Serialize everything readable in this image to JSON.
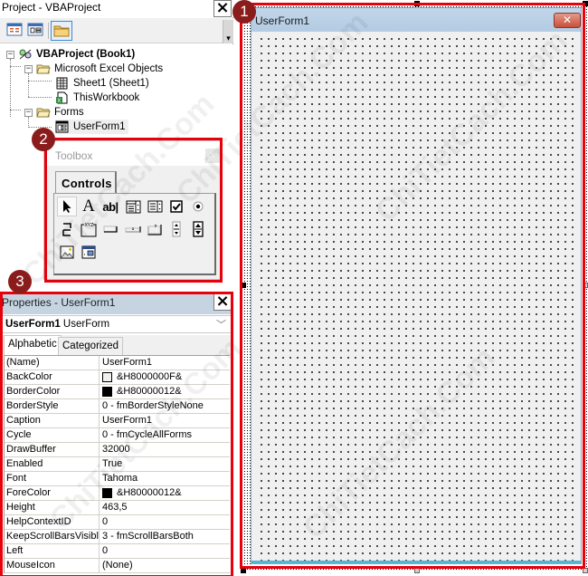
{
  "project_explorer": {
    "title": "Project - VBAProject",
    "toolbar": [
      {
        "name": "view-code-icon",
        "label": "View Code"
      },
      {
        "name": "view-object-icon",
        "label": "View Object"
      },
      {
        "name": "toggle-folders-icon",
        "label": "Toggle Folders"
      }
    ],
    "tree": {
      "root": "VBAProject (Book1)",
      "excel_objects_folder": "Microsoft Excel Objects",
      "sheet1": "Sheet1 (Sheet1)",
      "this_workbook": "ThisWorkbook",
      "forms_folder": "Forms",
      "userform1": "UserForm1"
    }
  },
  "toolbox": {
    "title": "Toolbox",
    "close_label": "x",
    "tab": "Controls",
    "tools": [
      {
        "name": "select-objects-tool",
        "glyph": "arrow"
      },
      {
        "name": "label-tool",
        "glyph": "A"
      },
      {
        "name": "textbox-tool",
        "glyph": "ab|"
      },
      {
        "name": "combobox-tool",
        "glyph": "combo"
      },
      {
        "name": "listbox-tool",
        "glyph": "list"
      },
      {
        "name": "checkbox-tool",
        "glyph": "check"
      },
      {
        "name": "optionbutton-tool",
        "glyph": "radio"
      },
      {
        "name": "togglebutton-tool",
        "glyph": "toggle"
      },
      {
        "name": "frame-tool",
        "glyph": "XYZ"
      },
      {
        "name": "commandbutton-tool",
        "glyph": "button"
      },
      {
        "name": "tabstrip-tool",
        "glyph": "tabstrip"
      },
      {
        "name": "multipage-tool",
        "glyph": "multipage"
      },
      {
        "name": "scrollbar-tool",
        "glyph": "scroll"
      },
      {
        "name": "spinbutton-tool",
        "glyph": "spin"
      },
      {
        "name": "image-tool",
        "glyph": "image"
      },
      {
        "name": "refedit-tool",
        "glyph": "refedit"
      }
    ]
  },
  "properties": {
    "title": "Properties - UserForm1",
    "object_name": "UserForm1",
    "object_type": "UserForm",
    "tabs": [
      "Alphabetic",
      "Categorized"
    ],
    "active_tab": "Alphabetic",
    "rows": [
      {
        "name": "(Name)",
        "value": "UserForm1"
      },
      {
        "name": "BackColor",
        "value": "&H8000000F&",
        "swatch": "#f0f0f0"
      },
      {
        "name": "BorderColor",
        "value": "&H80000012&",
        "swatch": "#000000"
      },
      {
        "name": "BorderStyle",
        "value": "0 - fmBorderStyleNone"
      },
      {
        "name": "Caption",
        "value": "UserForm1"
      },
      {
        "name": "Cycle",
        "value": "0 - fmCycleAllForms"
      },
      {
        "name": "DrawBuffer",
        "value": "32000"
      },
      {
        "name": "Enabled",
        "value": "True"
      },
      {
        "name": "Font",
        "value": "Tahoma"
      },
      {
        "name": "ForeColor",
        "value": "&H80000012&",
        "swatch": "#000000"
      },
      {
        "name": "Height",
        "value": "463,5"
      },
      {
        "name": "HelpContextID",
        "value": "0"
      },
      {
        "name": "KeepScrollBarsVisible",
        "value": "3 - fmScrollBarsBoth"
      },
      {
        "name": "Left",
        "value": "0"
      },
      {
        "name": "MouseIcon",
        "value": "(None)"
      }
    ]
  },
  "userform": {
    "caption": "UserForm1",
    "close_glyph": "✕"
  },
  "annotations": {
    "badge1": "1",
    "badge2": "2",
    "badge3": "3",
    "highlight_color": "#e8000b",
    "badge_color": "#8b1c1c"
  },
  "watermark": "ChiTietCach.Com"
}
